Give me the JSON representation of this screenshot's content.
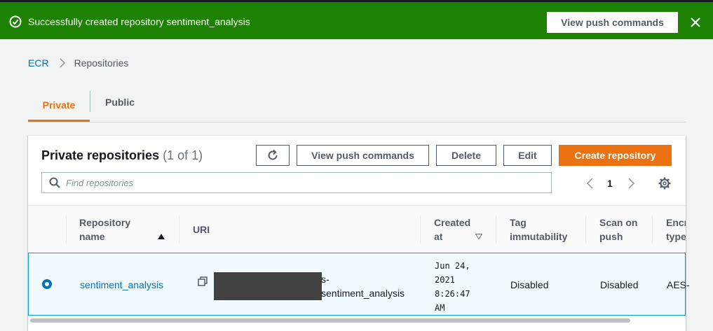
{
  "flash": {
    "message": "Successfully created repository sentiment_analysis",
    "button_label": "View push commands",
    "icon": "check-circle-icon",
    "close_icon": "close-icon",
    "color": "#1d8102"
  },
  "breadcrumb": {
    "items": [
      "ECR",
      "Repositories"
    ]
  },
  "tabs": [
    {
      "label": "Private",
      "active": true
    },
    {
      "label": "Public",
      "active": false
    }
  ],
  "panel": {
    "title": "Private repositories",
    "count": "(1 of 1)",
    "buttons": {
      "refresh_icon": "refresh-icon",
      "push": "View push commands",
      "delete": "Delete",
      "edit": "Edit",
      "create": "Create repository"
    },
    "search": {
      "placeholder": "Find repositories"
    },
    "pagination": {
      "page": "1"
    }
  },
  "table": {
    "columns": [
      {
        "line1": "Repository",
        "line2": "name",
        "sort": "ascending"
      },
      {
        "line1": "URI",
        "line2": ""
      },
      {
        "line1": "Created",
        "line2": "at",
        "sort": "descending"
      },
      {
        "line1": "Tag",
        "line2": "immutability"
      },
      {
        "line1": "Scan on",
        "line2": "push"
      },
      {
        "line1": "Encr",
        "line2": "type"
      }
    ],
    "rows": [
      {
        "selected": true,
        "name": "sentiment_analysis",
        "uri_line1": "s-",
        "uri_line2": "sentiment_analysis",
        "created_line1": "Jun 24,",
        "created_line2": "2021",
        "created_line3": "8:26:47",
        "created_line4": "AM",
        "tag_immutability": "Disabled",
        "scan_on_push": "Disabled",
        "encryption": "AES-"
      }
    ]
  },
  "colors": {
    "accent": "#ec7211",
    "link": "#0073bb",
    "success": "#1d8102"
  }
}
